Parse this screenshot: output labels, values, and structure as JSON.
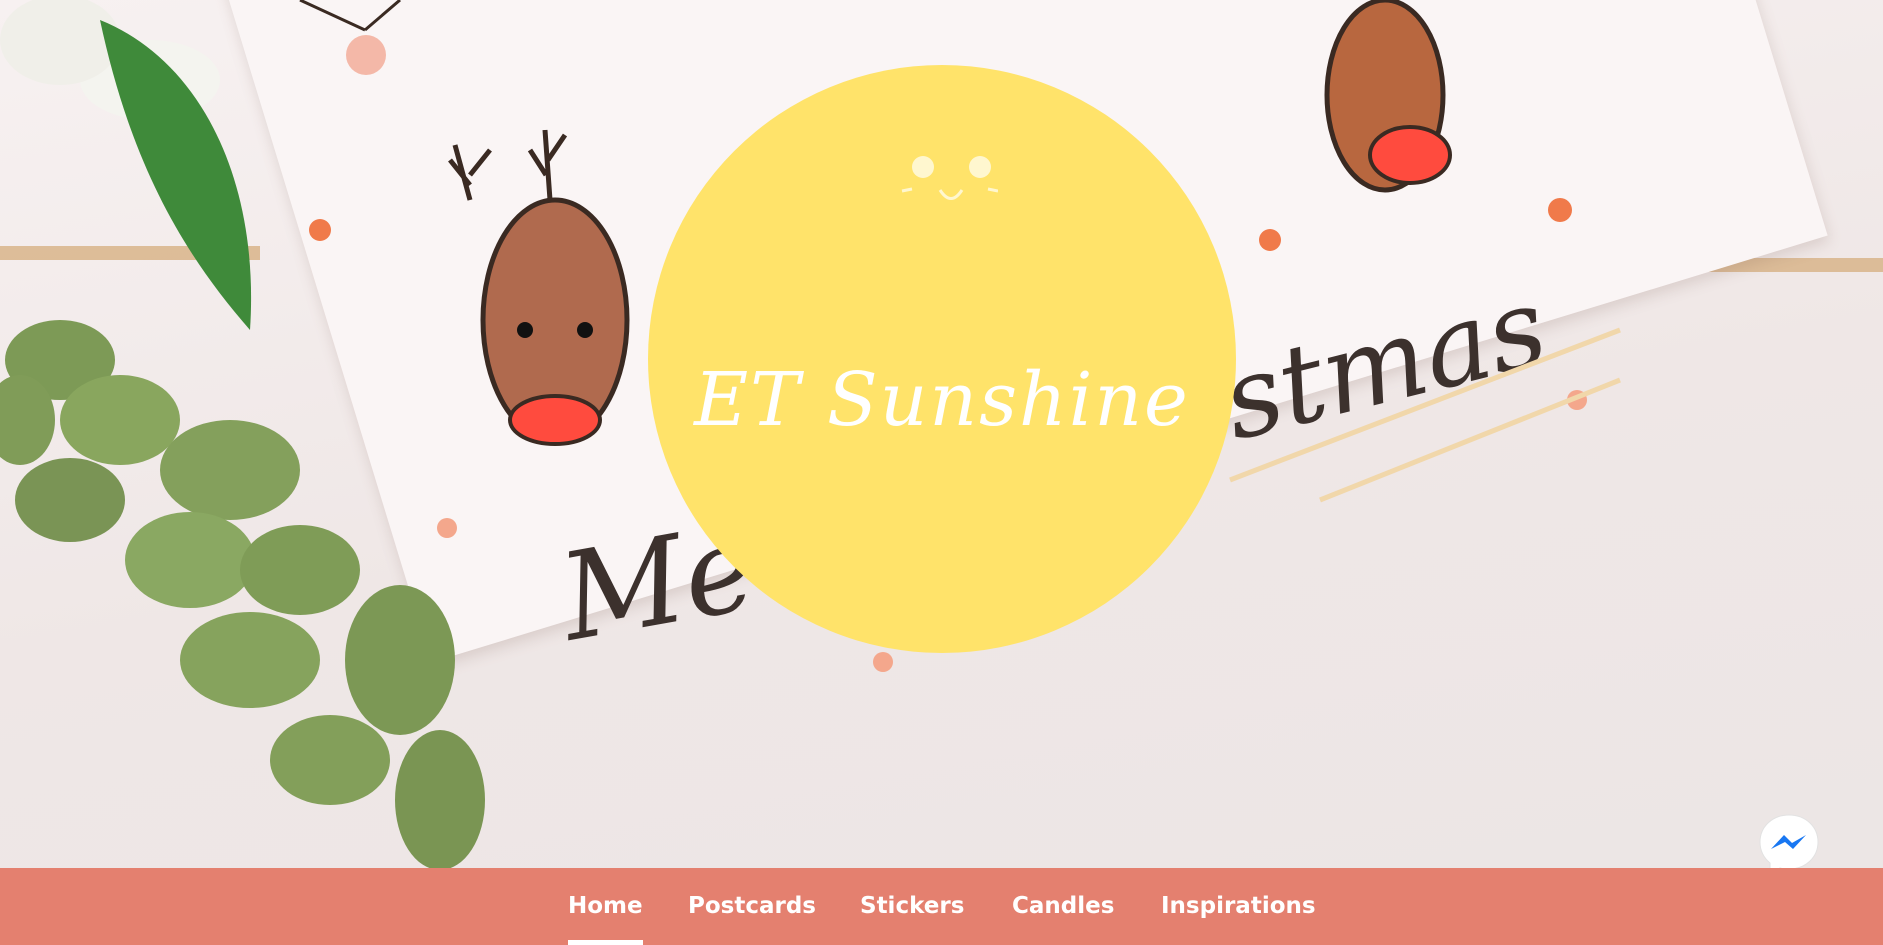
{
  "brand": {
    "name": "ET Sunshine",
    "circle_color": "#ffe36a"
  },
  "nav": {
    "background_color": "#e4806f",
    "items": [
      {
        "label": "Home",
        "active": true
      },
      {
        "label": "Postcards",
        "active": false
      },
      {
        "label": "Stickers",
        "active": false
      },
      {
        "label": "Candles",
        "active": false
      },
      {
        "label": "Inspirations",
        "active": false
      }
    ]
  },
  "chat_widget": {
    "icon": "messenger-icon"
  }
}
